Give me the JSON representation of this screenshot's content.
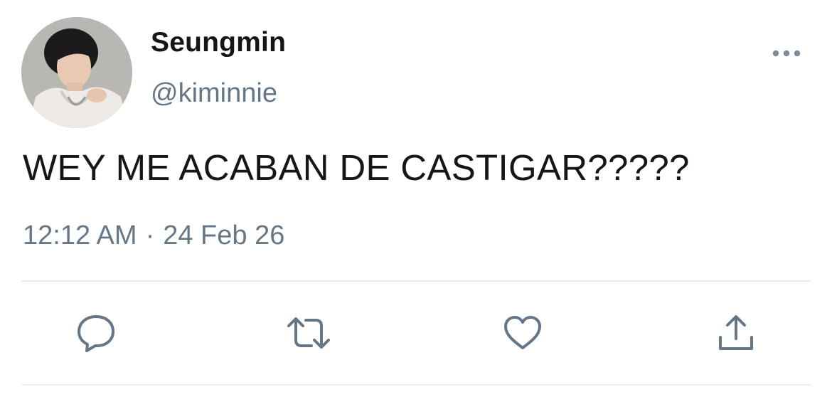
{
  "user": {
    "display_name": "Seungmin",
    "handle": "@kiminnie"
  },
  "tweet": {
    "text": "WEY ME ACABAN DE CASTIGAR?????",
    "time": "12:12 AM",
    "separator": "·",
    "date": "24 Feb 26"
  },
  "icons": {
    "more": "more-horizontal-icon",
    "reply": "reply-icon",
    "retweet": "retweet-icon",
    "like": "heart-icon",
    "share": "share-icon"
  },
  "colors": {
    "text": "#14171a",
    "secondary": "#657786",
    "divider": "#e6ecf0"
  }
}
